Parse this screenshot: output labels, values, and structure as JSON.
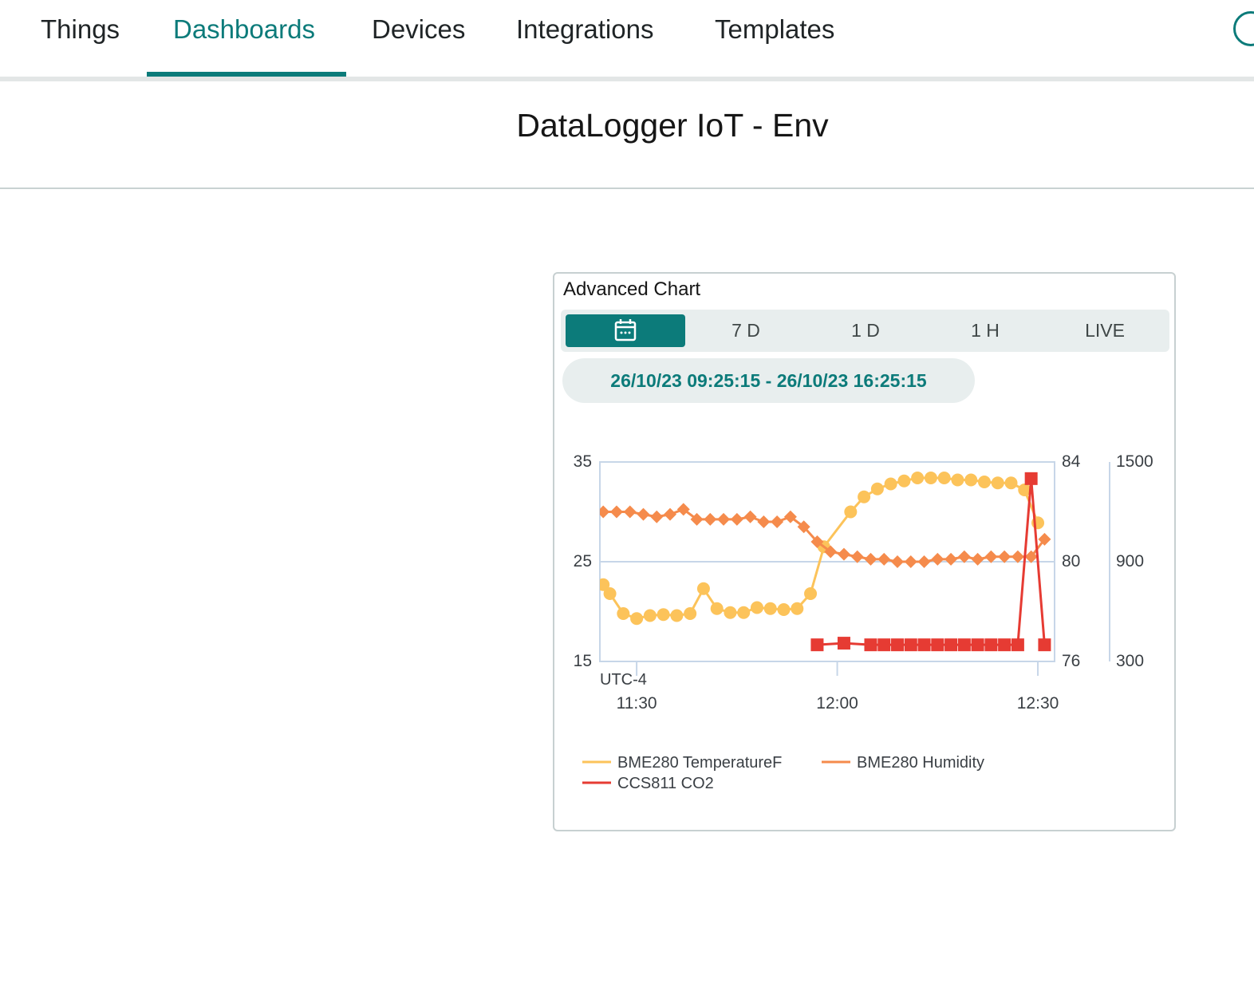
{
  "nav": {
    "tabs": [
      {
        "label": "Things"
      },
      {
        "label": "Dashboards"
      },
      {
        "label": "Devices"
      },
      {
        "label": "Integrations"
      },
      {
        "label": "Templates"
      }
    ],
    "active_tab": "Dashboards",
    "accent_color": "#0c7b7a"
  },
  "dashboard": {
    "title": "DataLogger IoT - Env"
  },
  "widget": {
    "title": "Advanced Chart",
    "range_buttons": [
      {
        "label": "",
        "icon": "calendar-icon",
        "active": true
      },
      {
        "label": "7 D"
      },
      {
        "label": "1 D"
      },
      {
        "label": "1 H"
      },
      {
        "label": "LIVE"
      }
    ],
    "date_range": "26/10/23 09:25:15 - 26/10/23 16:25:15"
  },
  "chart_data": {
    "type": "line",
    "timezone_label": "UTC-4",
    "x_unit": "time",
    "x_ticks": [
      "11:30",
      "12:00",
      "12:30"
    ],
    "grid": true,
    "legend_position": "bottom",
    "axes": {
      "left": {
        "ylim": [
          15,
          35
        ],
        "ticks": [
          "35",
          "25",
          "15"
        ]
      },
      "right": {
        "ylim": [
          76,
          84
        ],
        "ticks": [
          "84",
          "80",
          "76"
        ]
      },
      "far_right": {
        "ylim": [
          300,
          1500
        ],
        "ticks": [
          "1500",
          "900",
          "300"
        ]
      }
    },
    "series": [
      {
        "name": "BME280 TemperatureF",
        "axis": "left",
        "color": "#fcc35a",
        "marker": "circle",
        "points": [
          [
            "11:25",
            22.7
          ],
          [
            "11:26",
            21.8
          ],
          [
            "11:28",
            19.8
          ],
          [
            "11:30",
            19.3
          ],
          [
            "11:32",
            19.6
          ],
          [
            "11:34",
            19.7
          ],
          [
            "11:36",
            19.6
          ],
          [
            "11:38",
            19.8
          ],
          [
            "11:40",
            22.3
          ],
          [
            "11:42",
            20.3
          ],
          [
            "11:44",
            19.9
          ],
          [
            "11:46",
            19.9
          ],
          [
            "11:48",
            20.4
          ],
          [
            "11:50",
            20.3
          ],
          [
            "11:52",
            20.2
          ],
          [
            "11:54",
            20.3
          ],
          [
            "11:56",
            21.8
          ],
          [
            "11:58",
            26.5
          ],
          [
            "12:02",
            30.0
          ],
          [
            "12:04",
            31.5
          ],
          [
            "12:06",
            32.3
          ],
          [
            "12:08",
            32.8
          ],
          [
            "12:10",
            33.1
          ],
          [
            "12:12",
            33.4
          ],
          [
            "12:14",
            33.4
          ],
          [
            "12:16",
            33.4
          ],
          [
            "12:18",
            33.2
          ],
          [
            "12:20",
            33.2
          ],
          [
            "12:22",
            33.0
          ],
          [
            "12:24",
            32.9
          ],
          [
            "12:26",
            32.9
          ],
          [
            "12:28",
            32.2
          ],
          [
            "12:30",
            28.9
          ]
        ]
      },
      {
        "name": "BME280 Humidity",
        "axis": "right",
        "color": "#f58b4c",
        "marker": "diamond",
        "points": [
          [
            "11:25",
            82.0
          ],
          [
            "11:27",
            82.0
          ],
          [
            "11:29",
            82.0
          ],
          [
            "11:31",
            81.9
          ],
          [
            "11:33",
            81.8
          ],
          [
            "11:35",
            81.9
          ],
          [
            "11:37",
            82.1
          ],
          [
            "11:39",
            81.7
          ],
          [
            "11:41",
            81.7
          ],
          [
            "11:43",
            81.7
          ],
          [
            "11:45",
            81.7
          ],
          [
            "11:47",
            81.8
          ],
          [
            "11:49",
            81.6
          ],
          [
            "11:51",
            81.6
          ],
          [
            "11:53",
            81.8
          ],
          [
            "11:55",
            81.4
          ],
          [
            "11:57",
            80.8
          ],
          [
            "11:59",
            80.4
          ],
          [
            "12:01",
            80.3
          ],
          [
            "12:03",
            80.2
          ],
          [
            "12:05",
            80.1
          ],
          [
            "12:07",
            80.1
          ],
          [
            "12:09",
            80.0
          ],
          [
            "12:11",
            80.0
          ],
          [
            "12:13",
            80.0
          ],
          [
            "12:15",
            80.1
          ],
          [
            "12:17",
            80.1
          ],
          [
            "12:19",
            80.2
          ],
          [
            "12:21",
            80.1
          ],
          [
            "12:23",
            80.2
          ],
          [
            "12:25",
            80.2
          ],
          [
            "12:27",
            80.2
          ],
          [
            "12:29",
            80.2
          ],
          [
            "12:31",
            80.9
          ]
        ]
      },
      {
        "name": "CCS811 CO2",
        "axis": "far_right",
        "color": "#e63b33",
        "marker": "square",
        "points": [
          [
            "11:57",
            400
          ],
          [
            "12:01",
            410
          ],
          [
            "12:05",
            400
          ],
          [
            "12:07",
            400
          ],
          [
            "12:09",
            400
          ],
          [
            "12:11",
            400
          ],
          [
            "12:13",
            400
          ],
          [
            "12:15",
            400
          ],
          [
            "12:17",
            400
          ],
          [
            "12:19",
            400
          ],
          [
            "12:21",
            400
          ],
          [
            "12:23",
            400
          ],
          [
            "12:25",
            400
          ],
          [
            "12:27",
            400
          ],
          [
            "12:29",
            1400
          ],
          [
            "12:31",
            400
          ]
        ]
      }
    ]
  }
}
